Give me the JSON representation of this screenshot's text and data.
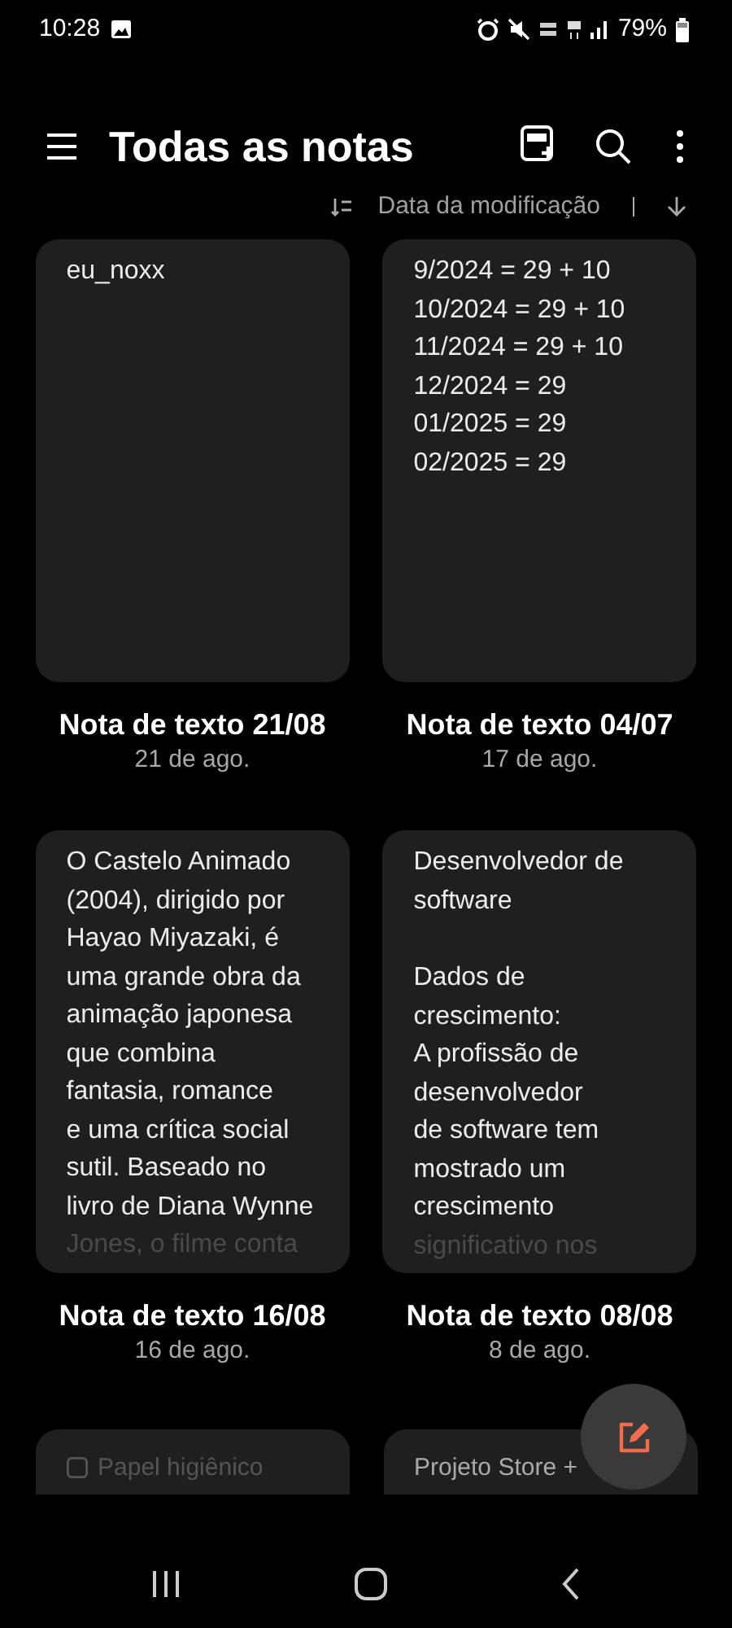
{
  "status_bar": {
    "time": "10:28",
    "battery": "79%"
  },
  "header": {
    "title": "Todas as notas"
  },
  "sort": {
    "label": "Data da modificação"
  },
  "notes": [
    {
      "paragraphs": [
        [
          "eu_noxx"
        ]
      ],
      "fade": false,
      "title": "Nota de texto 21/08",
      "date": "21 de ago."
    },
    {
      "paragraphs": [
        [
          "9/2024 = 29 + 10",
          "10/2024 = 29 + 10",
          "11/2024 = 29 + 10",
          "12/2024 = 29",
          "01/2025 = 29",
          "02/2025 = 29"
        ]
      ],
      "fade": false,
      "title": "Nota de texto 04/07",
      "date": "17 de ago."
    },
    {
      "paragraphs": [
        [
          "O Castelo Animado",
          "(2004), dirigido por",
          "Hayao Miyazaki, é",
          "uma grande obra da",
          "animação japonesa",
          "que combina",
          "fantasia, romance",
          "e uma crítica social",
          "sutil. Baseado no",
          "livro de Diana Wynne",
          "Jones, o filme conta"
        ]
      ],
      "fade": true,
      "title": "Nota de texto 16/08",
      "date": "16 de ago."
    },
    {
      "paragraphs": [
        [
          "Desenvolvedor de",
          "software"
        ],
        [
          "Dados de",
          "crescimento:",
          "A profissão de",
          "desenvolvedor",
          "de software tem",
          "mostrado um",
          "crescimento",
          "significativo nos"
        ]
      ],
      "fade": true,
      "title": "Nota de texto 08/08",
      "date": "8 de ago."
    }
  ],
  "partial_notes": [
    {
      "kind": "checklist",
      "text": "Papel higiênico"
    },
    {
      "kind": "text",
      "text": "Projeto Store +"
    }
  ]
}
